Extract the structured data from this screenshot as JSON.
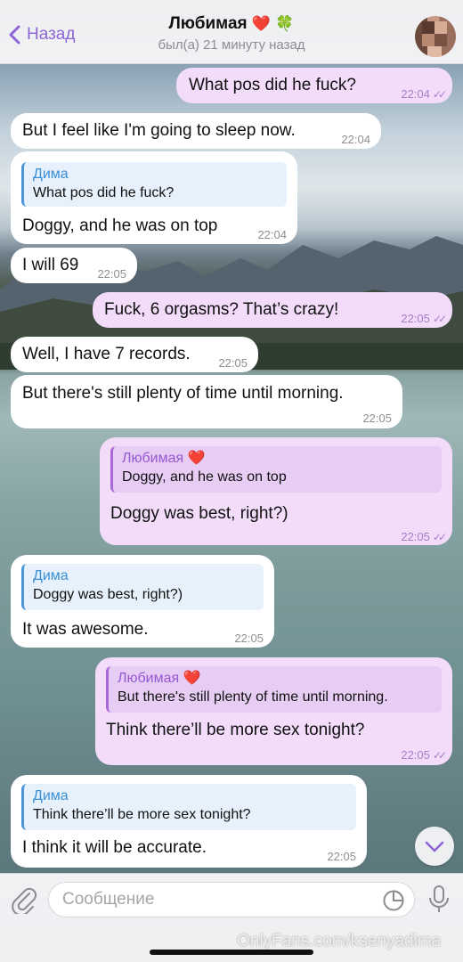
{
  "header": {
    "back_label": "Назад",
    "contact_name": "Любимая",
    "name_emoji_1": "❤️",
    "name_emoji_2": "🍀",
    "status": "был(а) 21 минуту назад"
  },
  "messages": [
    {
      "dir": "out",
      "text": "What pos did he fuck?",
      "time": "22:04",
      "status": "read"
    },
    {
      "dir": "in",
      "text": "But I feel like I'm going to sleep now.",
      "time": "22:04"
    },
    {
      "dir": "in",
      "reply_name": "Дима",
      "reply_text": "What pos did he fuck?",
      "text": "Doggy, and he was on top",
      "time": "22:04"
    },
    {
      "dir": "in",
      "text": "I will 69",
      "time": "22:05"
    },
    {
      "dir": "out",
      "text": "Fuck, 6 orgasms? That’s crazy!",
      "time": "22:05",
      "status": "read"
    },
    {
      "dir": "in",
      "text": "Well, I have 7 records.",
      "time": "22:05"
    },
    {
      "dir": "in",
      "text": "But there's still plenty of time until morning.",
      "time": "22:05"
    },
    {
      "dir": "out",
      "reply_name": "Любимая",
      "reply_emoji": "❤️",
      "reply_text": "Doggy, and he was on top",
      "text": "Doggy was best, right?)",
      "time": "22:05",
      "status": "read"
    },
    {
      "dir": "in",
      "reply_name": "Дима",
      "reply_text": "Doggy was best, right?)",
      "text": "It was awesome.",
      "time": "22:05"
    },
    {
      "dir": "out",
      "reply_name": "Любимая",
      "reply_emoji": "❤️",
      "reply_text": "But there's still plenty of time until morning.",
      "text": "Think there’ll be more sex tonight?",
      "time": "22:05",
      "status": "read"
    },
    {
      "dir": "in",
      "reply_name": "Дима",
      "reply_text": "Think there’ll be more sex tonight?",
      "text": "I think it will be accurate.",
      "time": "22:05"
    }
  ],
  "composer": {
    "placeholder": "Сообщение"
  },
  "watermark": "OnlyFans.com/ksenyadima",
  "colors": {
    "accent": "#8d66d4",
    "outgoing_bubble": "#f2dcfa",
    "incoming_bubble": "#ffffff",
    "reply_bar_in": "#4a95d6",
    "reply_bar_out": "#a768d8"
  }
}
